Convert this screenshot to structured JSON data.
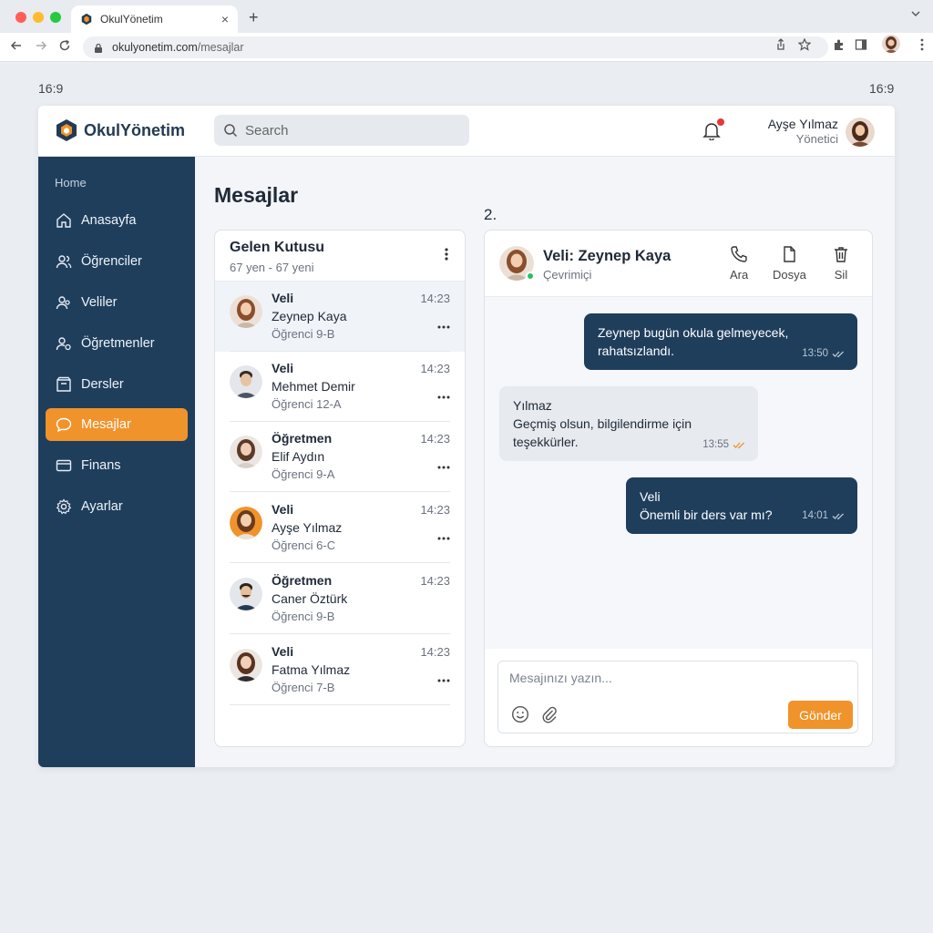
{
  "browser": {
    "tab_title": "OkulYönetim",
    "tab_close": "×",
    "new_tab": "+",
    "url_domain": "okulyonetim.com",
    "url_path": "/mesajlar"
  },
  "ratio_labels": {
    "left": "16:9",
    "right": "16:9"
  },
  "header": {
    "logo_text": "OkulYönetim",
    "search_placeholder": "Search",
    "user_name": "Ayşe Yılmaz",
    "user_role": "Yönetici"
  },
  "sidebar": {
    "section_label": "Home",
    "items": [
      {
        "label": "Anasayfa",
        "icon": "home-icon"
      },
      {
        "label": "Öğrenciler",
        "icon": "students-icon"
      },
      {
        "label": "Veliler",
        "icon": "parents-icon"
      },
      {
        "label": "Öğretmenler",
        "icon": "teachers-icon"
      },
      {
        "label": "Dersler",
        "icon": "courses-icon"
      },
      {
        "label": "Mesajlar",
        "icon": "chat-icon",
        "active": true
      },
      {
        "label": "Finans",
        "icon": "card-icon"
      },
      {
        "label": "Ayarlar",
        "icon": "gear-icon"
      }
    ]
  },
  "main": {
    "title": "Mesajlar",
    "step_label": "2."
  },
  "inbox": {
    "title": "Gelen Kutusu",
    "subtitle": "67 yen - 67 yeni",
    "conversations": [
      {
        "role": "Veli",
        "name": "Zeynep Kaya",
        "class": "Öğrenci 9-B",
        "time": "14:23",
        "selected": true
      },
      {
        "role": "Veli",
        "name": "Mehmet Demir",
        "class": "Öğrenci 12-A",
        "time": "14:23"
      },
      {
        "role": "Öğretmen",
        "name": "Elif Aydın",
        "class": "Öğrenci 9-A",
        "time": "14:23"
      },
      {
        "role": "Veli",
        "name": "Ayşe Yılmaz",
        "class": "Öğrenci 6-C",
        "time": "14:23"
      },
      {
        "role": "Öğretmen",
        "name": "Caner Öztürk",
        "class": "Öğrenci 9-B",
        "time": "14:23"
      },
      {
        "role": "Veli",
        "name": "Fatma Yılmaz",
        "class": "Öğrenci 7-B",
        "time": "14:23"
      }
    ]
  },
  "chat": {
    "title": "Veli: Zeynep Kaya",
    "status": "Çevrimiçi",
    "actions": {
      "call": "Ara",
      "file": "Dosya",
      "delete": "Sil"
    },
    "messages": [
      {
        "direction": "out",
        "sender": "",
        "text_line1": "Zeynep bugün okula gelmeyecek,",
        "text_line2": "rahatsızlandı.",
        "time": "13:50"
      },
      {
        "direction": "in",
        "sender": "Yılmaz",
        "text_line1": "Geçmiş olsun, bilgilendirme için",
        "text_line2": "teşekkürler.",
        "time": "13:55"
      },
      {
        "direction": "out",
        "sender": "Veli",
        "text_line1": "Önemli bir ders var mı?",
        "text_line2": "",
        "time": "14:01"
      }
    ],
    "input_placeholder": "Mesajınızı yazın...",
    "send_label": "Gönder"
  },
  "colors": {
    "accent": "#f0932b",
    "sidebar": "#1f3e5c",
    "online": "#22c55e",
    "badge": "#e53935"
  }
}
